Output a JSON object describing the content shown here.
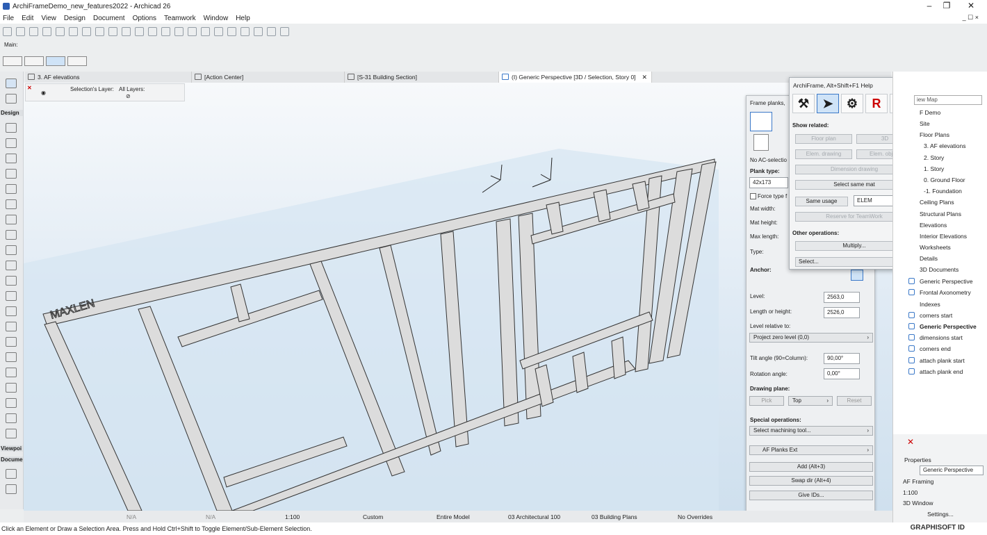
{
  "window": {
    "title": "ArchiFrameDemo_new_features2022 - Archicad 26"
  },
  "menu": [
    "File",
    "Edit",
    "View",
    "Design",
    "Document",
    "Options",
    "Teamwork",
    "Window",
    "Help"
  ],
  "menu_right": "_ ☐ ×",
  "toolbar": {
    "main_label": "Main:"
  },
  "tabs": [
    {
      "label": "3. AF elevations"
    },
    {
      "label": "[Action Center]"
    },
    {
      "label": "[S-31 Building Section]"
    },
    {
      "label": "(I) Generic Perspective [3D / Selection, Story 0]"
    }
  ],
  "layers": {
    "selection_label": "Selection's Layer:",
    "all_label": "All Layers:"
  },
  "leftbar": {
    "design": "Design",
    "viewpoint": "Viewpoi",
    "document": "Docume"
  },
  "model": {
    "stamp_text": "MAXLEN"
  },
  "frame_panel": {
    "title": "Frame planks,",
    "no_selection": "No AC-selectio",
    "plank_type_label": "Plank type:",
    "plank_type_value": "42x173",
    "force_type": "Force type f",
    "mat_width": "Mat width:",
    "mat_height": "Mat height:",
    "max_length": "Max length:",
    "type": "Type:",
    "anchor": "Anchor:",
    "level_label": "Level:",
    "level_value": "2563,0",
    "length_label": "Length or height:",
    "length_value": "2526,0",
    "level_rel_label": "Level relative to:",
    "level_rel_value": "Project zero level (0,0)",
    "tilt_label": "Tilt angle (90=Column):",
    "tilt_value": "90,00°",
    "rotation_label": "Rotation angle:",
    "rotation_value": "0,00°",
    "drawing_plane": "Drawing plane:",
    "pick": "Pick",
    "top": "Top",
    "reset": "Reset",
    "special_ops": "Special operations:",
    "machining": "Select machining tool...",
    "af_planks": "AF Planks Ext",
    "add": "Add (Alt+3)",
    "swap": "Swap dir (Alt+4)",
    "give_ids": "Give IDs..."
  },
  "help_panel": {
    "title": "ArchiFrame, Alt+Shift+F1 Help",
    "show_related": "Show related:",
    "floor_plan": "Floor plan",
    "three_d": "3D",
    "elem_drawing": "Elem. drawing",
    "elem_object": "Elem. object",
    "dimension_drawing": "Dimension drawing",
    "select_same_mat": "Select same mat",
    "same_usage": "Same usage",
    "same_usage_value": "ELEM",
    "reserve": "Reserve for TeamWork",
    "other_ops": "Other operations:",
    "multiply": "Multiply...",
    "select": "Select..."
  },
  "navigator": {
    "search_placeholder": "iew Map",
    "items": [
      "F Demo",
      "Site",
      "Floor Plans",
      "3. AF elevations",
      "2. Story",
      "1. Story",
      "0. Ground Floor",
      "-1. Foundation",
      "Ceiling Plans",
      "Structural Plans",
      "Elevations",
      "Interior Elevations",
      "Worksheets",
      "Details",
      "3D Documents",
      "Generic Perspective",
      "Frontal Axonometry",
      "Indexes",
      "corners start",
      "Generic Perspective",
      "dimensions start",
      "corners end",
      "attach plank start",
      "attach plank end"
    ]
  },
  "properties": {
    "header": "Properties",
    "name": "Generic Perspective",
    "framing": "AF Framing",
    "scale": "1:100",
    "window": "3D Window",
    "settings": "Settings..."
  },
  "statusbar": {
    "na1": "N/A",
    "na2": "N/A",
    "scale": "1:100",
    "custom": "Custom",
    "model": "Entire Model",
    "arch": "03 Architectural 100",
    "plans": "03 Building Plans",
    "overrides": "No Overrides"
  },
  "hint": "Click an Element or Draw a Selection Area. Press and Hold Ctrl+Shift to Toggle Element/Sub-Element Selection.",
  "brand": "GRAPHISOFT ID"
}
